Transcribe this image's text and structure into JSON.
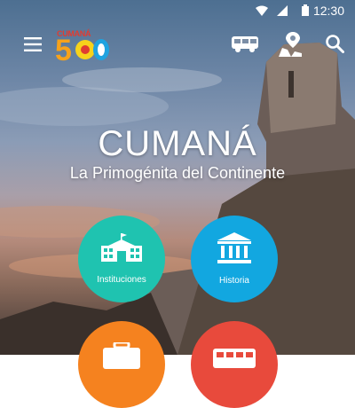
{
  "status_bar": {
    "time": "12:30",
    "icons": [
      "wifi-icon",
      "signal-icon",
      "battery-icon"
    ]
  },
  "app_bar": {
    "menu_icon": "menu-icon",
    "logo_text": "CUMANÁ",
    "logo_number": "500",
    "actions": [
      {
        "icon": "bus-icon"
      },
      {
        "icon": "map-pin-icon"
      },
      {
        "icon": "search-icon"
      }
    ]
  },
  "hero": {
    "title": "CUMANÁ",
    "subtitle": "La Primogénita del Continente"
  },
  "menu": {
    "items": [
      {
        "label": "Instituciones",
        "icon": "building-icon",
        "color": "#1fc3b0"
      },
      {
        "label": "Historia",
        "icon": "museum-icon",
        "color": "#12a7e0"
      },
      {
        "label": "",
        "icon": "suitcase-icon",
        "color": "#f5821f"
      },
      {
        "label": "",
        "icon": "bus-icon",
        "color": "#e84a3c"
      }
    ]
  },
  "colors": {
    "teal": "#1fc3b0",
    "blue": "#12a7e0",
    "orange": "#f5821f",
    "red": "#e84a3c"
  }
}
